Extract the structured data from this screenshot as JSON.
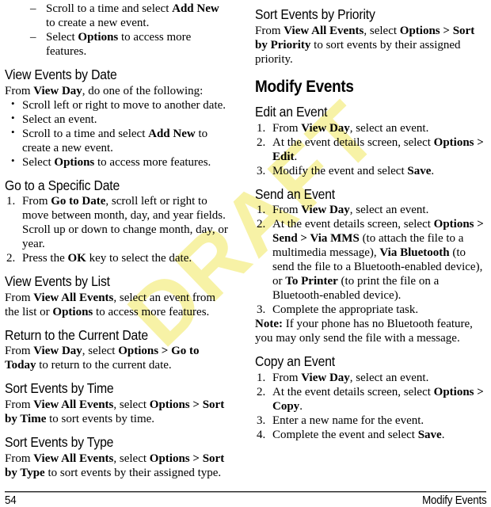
{
  "document": {
    "watermark": "DRAFT",
    "watermark_color": "#f7f2a6",
    "page_number": "54",
    "footer_section": "Modify Events"
  },
  "left_column": {
    "top_dash_list": [
      {
        "pre": "Scroll to a time and select ",
        "bold": "Add New",
        "post": " to create a new event.",
        "marker": "–"
      },
      {
        "pre": "Select ",
        "bold": "Options",
        "post": " to access more features.",
        "marker": "–"
      }
    ],
    "sections": [
      {
        "heading": "View Events by Date",
        "intro_pre": "From ",
        "intro_bold": "View Day",
        "intro_post": ", do one of the following:",
        "bullets": [
          {
            "marker": "•",
            "pre": "Scroll left or right to move to another date.",
            "bold": "",
            "post": ""
          },
          {
            "marker": "•",
            "pre": "Select an event.",
            "bold": "",
            "post": ""
          },
          {
            "marker": "•",
            "pre": "Scroll to a time and select ",
            "bold": "Add New",
            "post": " to create a new event."
          },
          {
            "marker": "•",
            "pre": "Select ",
            "bold": "Options",
            "post": " to access more features."
          }
        ]
      },
      {
        "heading": "Go to a Specific Date",
        "steps": [
          {
            "marker": "1.",
            "pre": "From ",
            "bold": "Go to Date",
            "post": ", scroll left or right to move between month, day, and year fields. Scroll up or down to change month, day, or year."
          },
          {
            "marker": "2.",
            "pre": "Press the ",
            "bold": "OK",
            "post": " key to select the date."
          }
        ]
      },
      {
        "heading": "View Events by List",
        "para_parts": [
          {
            "t": "From ",
            "b": false
          },
          {
            "t": "View All Events",
            "b": true
          },
          {
            "t": ", select an event from the list or ",
            "b": false
          },
          {
            "t": "Options",
            "b": true
          },
          {
            "t": " to access more features.",
            "b": false
          }
        ]
      },
      {
        "heading": "Return to the Current Date",
        "para_parts": [
          {
            "t": "From ",
            "b": false
          },
          {
            "t": "View Day",
            "b": true
          },
          {
            "t": ", select ",
            "b": false
          },
          {
            "t": "Options > Go to Today",
            "b": true
          },
          {
            "t": " to return to the current date.",
            "b": false
          }
        ]
      },
      {
        "heading": "Sort Events by Time",
        "para_parts": [
          {
            "t": "From ",
            "b": false
          },
          {
            "t": "View All Events",
            "b": true
          },
          {
            "t": ", select ",
            "b": false
          },
          {
            "t": "Options > Sort by Time",
            "b": true
          },
          {
            "t": " to sort events by time.",
            "b": false
          }
        ]
      },
      {
        "heading": "Sort Events by Type",
        "para_parts": [
          {
            "t": "From ",
            "b": false
          },
          {
            "t": "View All Events",
            "b": true
          },
          {
            "t": ", select ",
            "b": false
          },
          {
            "t": "Options > Sort by Type",
            "b": true
          },
          {
            "t": " to sort events by their assigned type.",
            "b": false
          }
        ]
      }
    ]
  },
  "right_column": {
    "first_section": {
      "heading": "Sort Events by Priority",
      "para_parts": [
        {
          "t": "From ",
          "b": false
        },
        {
          "t": "View All Events",
          "b": true
        },
        {
          "t": ", select ",
          "b": false
        },
        {
          "t": "Options > Sort by Priority",
          "b": true
        },
        {
          "t": " to sort events by their assigned priority.",
          "b": false
        }
      ]
    },
    "chapter_heading": "Modify Events",
    "sections": [
      {
        "heading": "Edit an Event",
        "steps": [
          {
            "marker": "1.",
            "parts": [
              {
                "t": "From ",
                "b": false
              },
              {
                "t": "View Day",
                "b": true
              },
              {
                "t": ", select an event.",
                "b": false
              }
            ]
          },
          {
            "marker": "2.",
            "parts": [
              {
                "t": "At the event details screen, select ",
                "b": false
              },
              {
                "t": "Options > Edit",
                "b": true
              },
              {
                "t": ".",
                "b": false
              }
            ]
          },
          {
            "marker": "3.",
            "parts": [
              {
                "t": "Modify the event and select ",
                "b": false
              },
              {
                "t": "Save",
                "b": true
              },
              {
                "t": ".",
                "b": false
              }
            ]
          }
        ]
      },
      {
        "heading": "Send an Event",
        "steps": [
          {
            "marker": "1.",
            "parts": [
              {
                "t": "From ",
                "b": false
              },
              {
                "t": "View Day",
                "b": true
              },
              {
                "t": ", select an event.",
                "b": false
              }
            ]
          },
          {
            "marker": "2.",
            "parts": [
              {
                "t": "At the event details screen, select ",
                "b": false
              },
              {
                "t": "Options > Send > Via MMS",
                "b": true
              },
              {
                "t": " (to attach the file to a multimedia message), ",
                "b": false
              },
              {
                "t": "Via Bluetooth",
                "b": true
              },
              {
                "t": " (to send the file to a Bluetooth-enabled device), or ",
                "b": false
              },
              {
                "t": "To Printer",
                "b": true
              },
              {
                "t": " (to print the file on a Bluetooth-enabled device).",
                "b": false
              }
            ]
          },
          {
            "marker": "3.",
            "parts": [
              {
                "t": "Complete the appropriate task.",
                "b": false
              }
            ]
          }
        ],
        "note": {
          "label": "Note:",
          "text": " If your phone has no Bluetooth feature, you may only send the file with a message."
        }
      },
      {
        "heading": "Copy an Event",
        "steps": [
          {
            "marker": "1.",
            "parts": [
              {
                "t": "From ",
                "b": false
              },
              {
                "t": "View Day",
                "b": true
              },
              {
                "t": ", select an event.",
                "b": false
              }
            ]
          },
          {
            "marker": "2.",
            "parts": [
              {
                "t": "At the event details screen, select ",
                "b": false
              },
              {
                "t": "Options > Copy",
                "b": true
              },
              {
                "t": ".",
                "b": false
              }
            ]
          },
          {
            "marker": "3.",
            "parts": [
              {
                "t": "Enter a new name for the event.",
                "b": false
              }
            ]
          },
          {
            "marker": "4.",
            "parts": [
              {
                "t": "Complete the event and select ",
                "b": false
              },
              {
                "t": "Save",
                "b": true
              },
              {
                "t": ".",
                "b": false
              }
            ]
          }
        ]
      }
    ]
  }
}
